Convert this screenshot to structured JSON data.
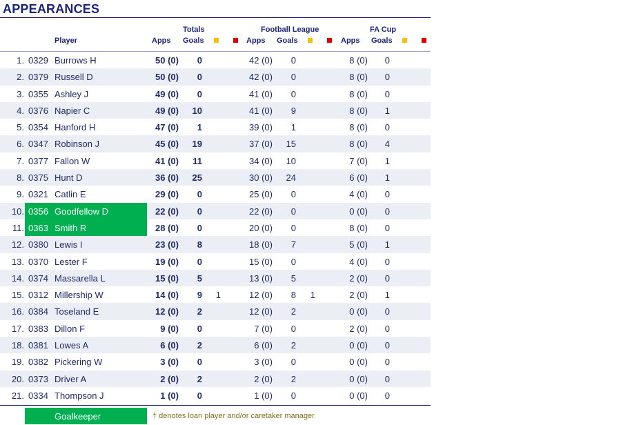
{
  "title": "APPEARANCES",
  "headers": {
    "player": "Player",
    "totals": "Totals",
    "football_league": "Football League",
    "fa_cup": "FA Cup",
    "apps": "Apps",
    "goals": "Goals"
  },
  "colors": {
    "yellow_card": "#f5c200",
    "red_card": "#e00000",
    "goalkeeper": "#00b050"
  },
  "rows": [
    {
      "num": "1.",
      "code": "0329",
      "name": "Burrows H",
      "tapps": "50 (0)",
      "tgoals": "0",
      "ty": "",
      "fapps": "42 (0)",
      "fgoals": "0",
      "fy": "",
      "capps": "8 (0)",
      "cgoals": "0",
      "gk": false
    },
    {
      "num": "2.",
      "code": "0379",
      "name": "Russell D",
      "tapps": "50 (0)",
      "tgoals": "0",
      "ty": "",
      "fapps": "42 (0)",
      "fgoals": "0",
      "fy": "",
      "capps": "8 (0)",
      "cgoals": "0",
      "gk": false
    },
    {
      "num": "3.",
      "code": "0355",
      "name": "Ashley J",
      "tapps": "49 (0)",
      "tgoals": "0",
      "ty": "",
      "fapps": "41 (0)",
      "fgoals": "0",
      "fy": "",
      "capps": "8 (0)",
      "cgoals": "0",
      "gk": false
    },
    {
      "num": "4.",
      "code": "0376",
      "name": "Napier C",
      "tapps": "49 (0)",
      "tgoals": "10",
      "ty": "",
      "fapps": "41 (0)",
      "fgoals": "9",
      "fy": "",
      "capps": "8 (0)",
      "cgoals": "1",
      "gk": false
    },
    {
      "num": "5.",
      "code": "0354",
      "name": "Hanford H",
      "tapps": "47 (0)",
      "tgoals": "1",
      "ty": "",
      "fapps": "39 (0)",
      "fgoals": "1",
      "fy": "",
      "capps": "8 (0)",
      "cgoals": "0",
      "gk": false
    },
    {
      "num": "6.",
      "code": "0347",
      "name": "Robinson J",
      "tapps": "45 (0)",
      "tgoals": "19",
      "ty": "",
      "fapps": "37 (0)",
      "fgoals": "15",
      "fy": "",
      "capps": "8 (0)",
      "cgoals": "4",
      "gk": false
    },
    {
      "num": "7.",
      "code": "0377",
      "name": "Fallon W",
      "tapps": "41 (0)",
      "tgoals": "11",
      "ty": "",
      "fapps": "34 (0)",
      "fgoals": "10",
      "fy": "",
      "capps": "7 (0)",
      "cgoals": "1",
      "gk": false
    },
    {
      "num": "8.",
      "code": "0375",
      "name": "Hunt D",
      "tapps": "36 (0)",
      "tgoals": "25",
      "ty": "",
      "fapps": "30 (0)",
      "fgoals": "24",
      "fy": "",
      "capps": "6 (0)",
      "cgoals": "1",
      "gk": false
    },
    {
      "num": "9.",
      "code": "0321",
      "name": "Catlin E",
      "tapps": "29 (0)",
      "tgoals": "0",
      "ty": "",
      "fapps": "25 (0)",
      "fgoals": "0",
      "fy": "",
      "capps": "4 (0)",
      "cgoals": "0",
      "gk": false
    },
    {
      "num": "10.",
      "code": "0356",
      "name": "Goodfellow D",
      "tapps": "22 (0)",
      "tgoals": "0",
      "ty": "",
      "fapps": "22 (0)",
      "fgoals": "0",
      "fy": "",
      "capps": "0 (0)",
      "cgoals": "0",
      "gk": true
    },
    {
      "num": "11.",
      "code": "0363",
      "name": "Smith R",
      "tapps": "28 (0)",
      "tgoals": "0",
      "ty": "",
      "fapps": "20 (0)",
      "fgoals": "0",
      "fy": "",
      "capps": "8 (0)",
      "cgoals": "0",
      "gk": true
    },
    {
      "num": "12.",
      "code": "0380",
      "name": "Lewis I",
      "tapps": "23 (0)",
      "tgoals": "8",
      "ty": "",
      "fapps": "18 (0)",
      "fgoals": "7",
      "fy": "",
      "capps": "5 (0)",
      "cgoals": "1",
      "gk": false
    },
    {
      "num": "13.",
      "code": "0370",
      "name": "Lester F",
      "tapps": "19 (0)",
      "tgoals": "0",
      "ty": "",
      "fapps": "15 (0)",
      "fgoals": "0",
      "fy": "",
      "capps": "4 (0)",
      "cgoals": "0",
      "gk": false
    },
    {
      "num": "14.",
      "code": "0374",
      "name": "Massarella L",
      "tapps": "15 (0)",
      "tgoals": "5",
      "ty": "",
      "fapps": "13 (0)",
      "fgoals": "5",
      "fy": "",
      "capps": "2 (0)",
      "cgoals": "0",
      "gk": false
    },
    {
      "num": "15.",
      "code": "0312",
      "name": "Millership W",
      "tapps": "14 (0)",
      "tgoals": "9",
      "ty": "1",
      "fapps": "12 (0)",
      "fgoals": "8",
      "fy": "1",
      "capps": "2 (0)",
      "cgoals": "1",
      "gk": false
    },
    {
      "num": "16.",
      "code": "0384",
      "name": "Toseland E",
      "tapps": "12 (0)",
      "tgoals": "2",
      "ty": "",
      "fapps": "12 (0)",
      "fgoals": "2",
      "fy": "",
      "capps": "0 (0)",
      "cgoals": "0",
      "gk": false
    },
    {
      "num": "17.",
      "code": "0383",
      "name": "Dillon F",
      "tapps": "9 (0)",
      "tgoals": "0",
      "ty": "",
      "fapps": "7 (0)",
      "fgoals": "0",
      "fy": "",
      "capps": "2 (0)",
      "cgoals": "0",
      "gk": false
    },
    {
      "num": "18.",
      "code": "0381",
      "name": "Lowes A",
      "tapps": "6 (0)",
      "tgoals": "2",
      "ty": "",
      "fapps": "6 (0)",
      "fgoals": "2",
      "fy": "",
      "capps": "0 (0)",
      "cgoals": "0",
      "gk": false
    },
    {
      "num": "19.",
      "code": "0382",
      "name": "Pickering W",
      "tapps": "3 (0)",
      "tgoals": "0",
      "ty": "",
      "fapps": "3 (0)",
      "fgoals": "0",
      "fy": "",
      "capps": "0 (0)",
      "cgoals": "0",
      "gk": false
    },
    {
      "num": "20.",
      "code": "0373",
      "name": "Driver A",
      "tapps": "2 (0)",
      "tgoals": "2",
      "ty": "",
      "fapps": "2 (0)",
      "fgoals": "2",
      "fy": "",
      "capps": "0 (0)",
      "cgoals": "0",
      "gk": false
    },
    {
      "num": "21.",
      "code": "0334",
      "name": "Thompson J",
      "tapps": "1 (0)",
      "tgoals": "0",
      "ty": "",
      "fapps": "1 (0)",
      "fgoals": "0",
      "fy": "",
      "capps": "0 (0)",
      "cgoals": "0",
      "gk": false
    }
  ],
  "legend": {
    "goalkeeper": "Goalkeeper",
    "note": "† denotes loan player and/or caretaker manager"
  }
}
